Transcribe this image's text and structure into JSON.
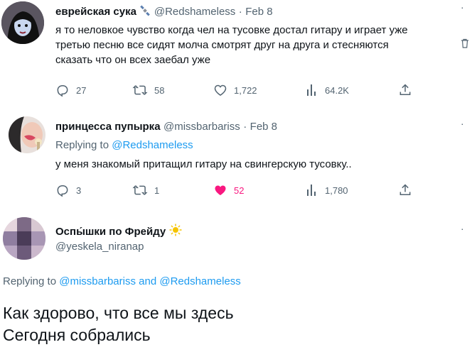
{
  "tweet1": {
    "display_name": "еврейская сука",
    "handle": "@Redshameless",
    "sep": "·",
    "date": "Feb 8",
    "text_lines": [
      "я то неловкое чувство когда чел на тусовке достал гитару и играет уже",
      "третью песню все сидят молча смотрят друг на друга и стесняются",
      "сказать что он всех заебал уже"
    ],
    "actions": {
      "replies": "27",
      "retweets": "58",
      "likes": "1,722",
      "views": "64.2K"
    }
  },
  "tweet2": {
    "display_name": "принцесса пупырка",
    "handle": "@missbarbariss",
    "sep": "·",
    "date": "Feb 8",
    "replying_prefix": "Replying to",
    "replying_to": "@Redshameless",
    "text": "у меня знакомый притащил гитару на свингерскую тусовку..",
    "actions": {
      "replies": "3",
      "retweets": "1",
      "likes": "52",
      "views": "1,780"
    },
    "like_color": "#f91880"
  },
  "tweet3": {
    "display_name": "Оспы́шки по Фрейду",
    "handle": "@yeskela_niranap",
    "replying_prefix": "Replying to",
    "replying_to_1": "@missbarbariss",
    "replying_and": "and",
    "replying_to_2": "@Redshameless",
    "text_lines": [
      "Как здорово, что все мы здесь",
      "Сегодня собрались"
    ]
  },
  "colors": {
    "accent": "#1d9bf0",
    "muted": "#536471",
    "text": "#0f1419"
  }
}
